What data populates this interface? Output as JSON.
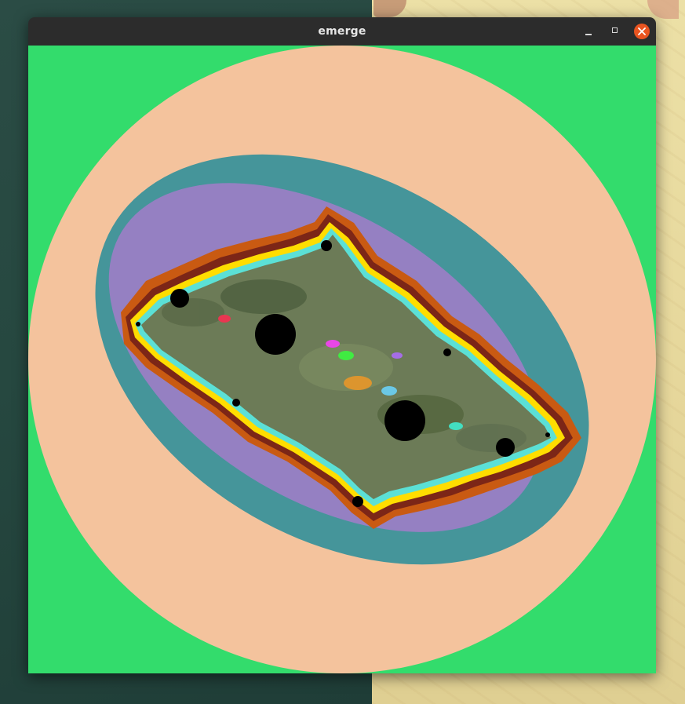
{
  "window": {
    "title": "emerge",
    "controls": {
      "minimize_icon": "minimize-icon",
      "maximize_icon": "maximize-icon",
      "close_icon": "close-icon"
    }
  },
  "fractal": {
    "background_color": "#33dc6c",
    "band_colors": [
      "#f4c39d",
      "#45959a",
      "#9580c2",
      "#c95a12",
      "#7c2617",
      "#ffdd00",
      "#e8ff7a",
      "#5be0d6",
      "#000000"
    ]
  }
}
